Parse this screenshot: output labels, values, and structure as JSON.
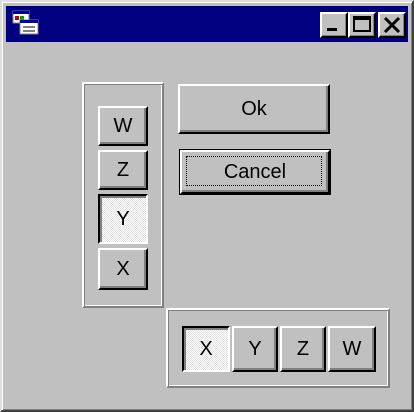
{
  "window": {
    "title": "",
    "icon": "app-window-icon",
    "controls": [
      "minimize-icon",
      "maximize-icon",
      "close-icon"
    ]
  },
  "vertical_group": {
    "buttons": [
      "W",
      "Z",
      "Y",
      "X"
    ],
    "pressed": "Y"
  },
  "horizontal_group": {
    "buttons": [
      "X",
      "Y",
      "Z",
      "W"
    ],
    "pressed": "X"
  },
  "dialog_buttons": {
    "ok_label": "Ok",
    "cancel_label": "Cancel",
    "default": "Cancel"
  },
  "colors": {
    "titlebar": "#000080",
    "face": "#c0c0c0"
  }
}
